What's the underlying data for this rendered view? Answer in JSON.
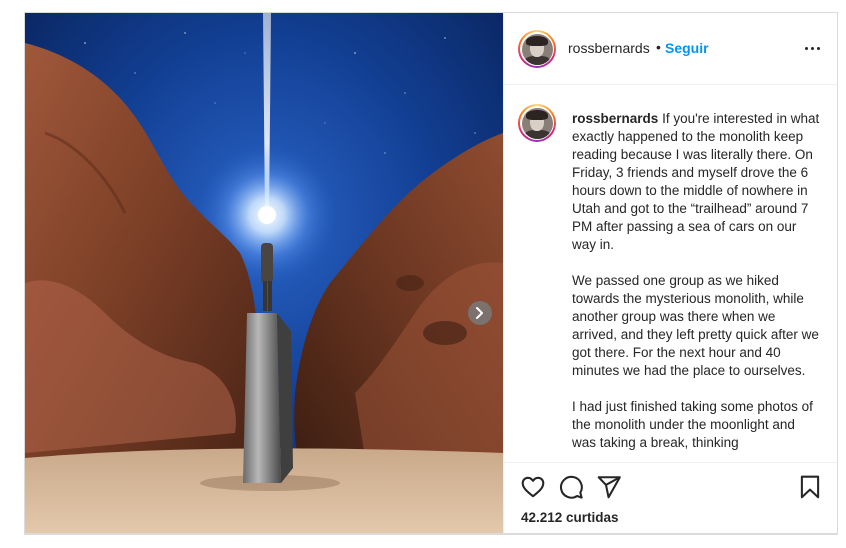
{
  "post": {
    "username": "rossbernards",
    "separator": "•",
    "follow_label": "Seguir",
    "more_icon": "more-options-icon",
    "caption_username": "rossbernards",
    "caption_paragraphs": [
      "If you're interested in what exactly happened to the monolith keep reading because I was literally there. On Friday, 3 friends and myself drove the 6 hours down to the middle of nowhere in Utah and got to the “trailhead” around 7 PM after passing a sea of cars on our way in.",
      "We passed one group as we hiked towards the mysterious monolith, while another group was there when we arrived, and they left pretty quick after we got there. For the next hour and 40 minutes we had the place to ourselves.",
      "I had just finished taking some photos of the monolith under the moonlight and was taking a break, thinking"
    ],
    "likes_text": "42.212 curtidas"
  },
  "media": {
    "description_icon": "photo-monolith-canyon",
    "next_icon": "chevron-right-icon"
  },
  "colors": {
    "accent": "#0095f6",
    "text": "#262626",
    "border": "#dbdbdb"
  }
}
